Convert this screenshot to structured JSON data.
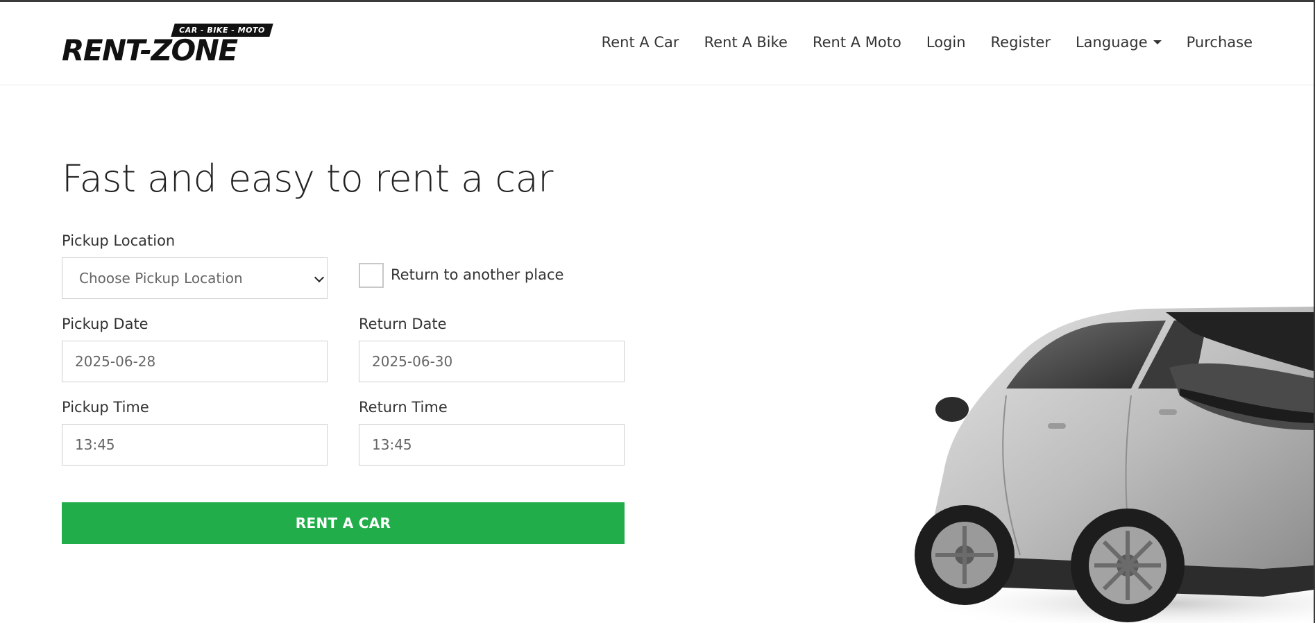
{
  "logo": {
    "tagline": "CAR - BIKE - MOTO",
    "name": "RENT-ZONE"
  },
  "nav": {
    "items": [
      {
        "label": "Rent A Car"
      },
      {
        "label": "Rent A Bike"
      },
      {
        "label": "Rent A Moto"
      },
      {
        "label": "Login"
      },
      {
        "label": "Register"
      },
      {
        "label": "Language"
      },
      {
        "label": "Purchase"
      }
    ]
  },
  "hero": {
    "title": "Fast and easy to rent a car"
  },
  "form": {
    "pickup_location": {
      "label": "Pickup Location",
      "value": "Choose Pickup Location"
    },
    "return_other": {
      "label": "Return to another place",
      "checked": false
    },
    "pickup_date": {
      "label": "Pickup Date",
      "value": "2025-06-28"
    },
    "return_date": {
      "label": "Return Date",
      "value": "2025-06-30"
    },
    "pickup_time": {
      "label": "Pickup Time",
      "value": "13:45"
    },
    "return_time": {
      "label": "Return Time",
      "value": "13:45"
    },
    "submit_label": "RENT A CAR"
  },
  "colors": {
    "accent": "#21ad49",
    "text": "#222222",
    "border": "#cfcfcf"
  }
}
